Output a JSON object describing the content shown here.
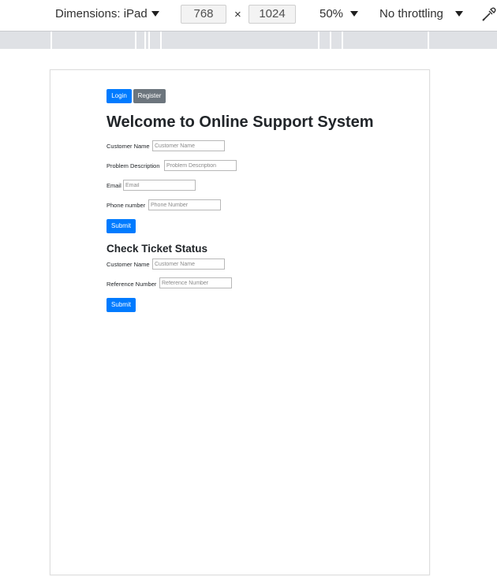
{
  "devtools": {
    "device_label": "Dimensions: iPad",
    "width_value": "768",
    "height_value": "1024",
    "times_symbol": "×",
    "zoom_label": "50%",
    "throttling_label": "No throttling"
  },
  "nav": {
    "login_label": "Login",
    "register_label": "Register"
  },
  "page": {
    "title": "Welcome to Online Support System"
  },
  "ticket_form": {
    "customer_name_label": "Customer Name",
    "customer_name_placeholder": "Customer Name",
    "problem_label": "Problem Description",
    "problem_placeholder": "Problem Description",
    "email_label": "Email",
    "email_placeholder": "Email",
    "phone_label": "Phone number",
    "phone_placeholder": "Phone Number",
    "submit_label": "Submit"
  },
  "status_form": {
    "heading": "Check Ticket Status",
    "customer_name_label": "Customer Name",
    "customer_name_placeholder": "Customer Name",
    "reference_label": "Reference Number",
    "reference_placeholder": "Reference Number",
    "submit_label": "Submit"
  },
  "colors": {
    "primary": "#007bff",
    "secondary": "#6c757d"
  },
  "icons": {
    "eyedropper": "eyedropper-icon",
    "dropdown": "caret-down-icon"
  }
}
